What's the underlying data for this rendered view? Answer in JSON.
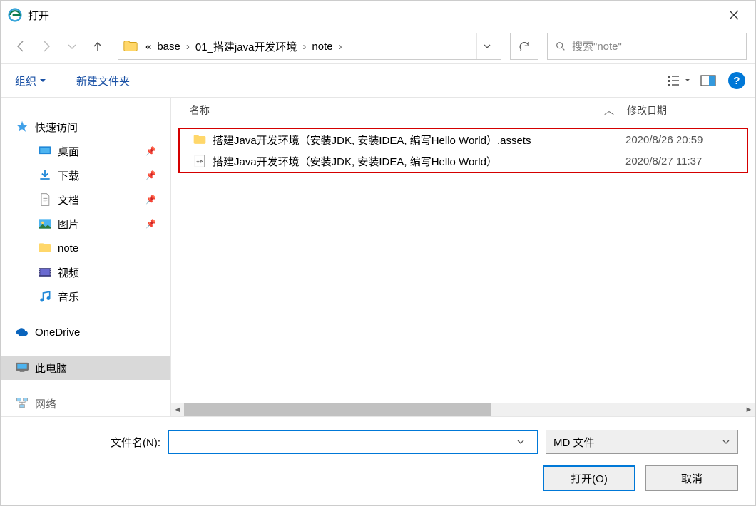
{
  "window": {
    "title": "打开"
  },
  "breadcrumb": {
    "prefix": "«",
    "items": [
      "base",
      "01_搭建java开发环境",
      "note"
    ]
  },
  "search": {
    "placeholder": "搜索\"note\""
  },
  "toolbar": {
    "organize": "组织",
    "new_folder": "新建文件夹"
  },
  "sidebar": {
    "quick_access": "快速访问",
    "desktop": "桌面",
    "downloads": "下载",
    "documents": "文档",
    "pictures": "图片",
    "note": "note",
    "videos": "视频",
    "music": "音乐",
    "onedrive": "OneDrive",
    "this_pc": "此电脑",
    "network": "网络"
  },
  "columns": {
    "name": "名称",
    "modified": "修改日期"
  },
  "files": [
    {
      "name": "搭建Java开发环境（安装JDK, 安装IDEA, 编写Hello World）.assets",
      "date": "2020/8/26 20:59",
      "type": "folder"
    },
    {
      "name": "搭建Java开发环境（安装JDK, 安装IDEA, 编写Hello World）",
      "date": "2020/8/27 11:37",
      "type": "md"
    }
  ],
  "bottom": {
    "filename_label": "文件名(N):",
    "filename_value": "",
    "filetype": "MD 文件",
    "open": "打开(O)",
    "cancel": "取消"
  }
}
